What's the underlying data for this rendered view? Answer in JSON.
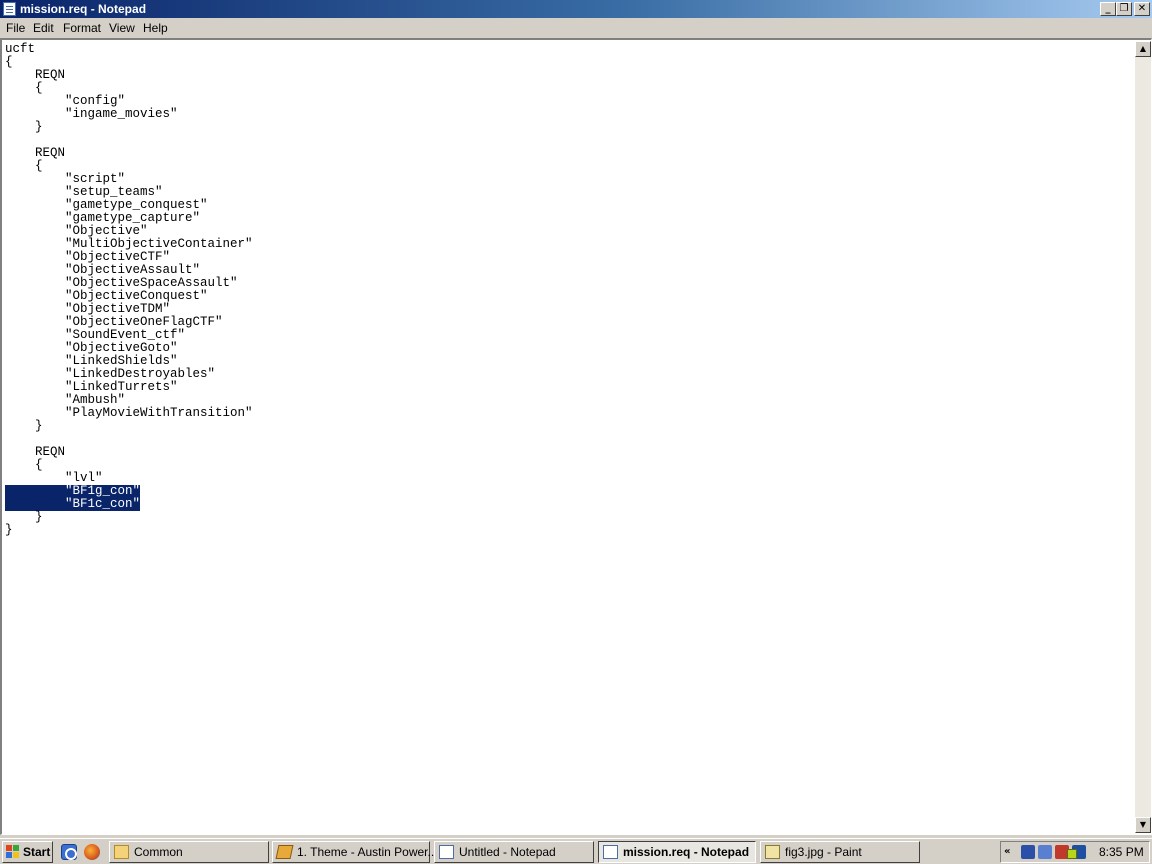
{
  "window": {
    "title": "mission.req - Notepad"
  },
  "titlebar_buttons": {
    "minimize": "_",
    "maximize": "❐",
    "close": "✕"
  },
  "menu": {
    "file": "File",
    "edit": "Edit",
    "format": "Format",
    "view": "View",
    "help": "Help"
  },
  "document": {
    "lines": [
      "ucft",
      "{",
      "    REQN",
      "    {",
      "        \"config\"",
      "        \"ingame_movies\"",
      "    }",
      "",
      "    REQN",
      "    {",
      "        \"script\"",
      "        \"setup_teams\"",
      "        \"gametype_conquest\"",
      "        \"gametype_capture\"",
      "        \"Objective\"",
      "        \"MultiObjectiveContainer\"",
      "        \"ObjectiveCTF\"",
      "        \"ObjectiveAssault\"",
      "        \"ObjectiveSpaceAssault\"",
      "        \"ObjectiveConquest\"",
      "        \"ObjectiveTDM\"",
      "        \"ObjectiveOneFlagCTF\"",
      "        \"SoundEvent_ctf\"",
      "        \"ObjectiveGoto\"",
      "        \"LinkedShields\"",
      "        \"LinkedDestroyables\"",
      "        \"LinkedTurrets\"",
      "        \"Ambush\"",
      "        \"PlayMovieWithTransition\"",
      "    }",
      "",
      "    REQN",
      "    {",
      "        \"lvl\"",
      "        \"BF1g_con\"",
      "        \"BF1c_con\"",
      "    }",
      "}"
    ],
    "selected_lines": [
      34,
      35
    ]
  },
  "scrollbar": {
    "up": "▲",
    "down": "▼"
  },
  "taskbar": {
    "start_label": "Start",
    "tasks": [
      {
        "label": "Common",
        "icon": "folder-icon"
      },
      {
        "label": "1. Theme - Austin Power...",
        "icon": "winamp-icon"
      },
      {
        "label": "Untitled - Notepad",
        "icon": "notepad-icon"
      },
      {
        "label": "mission.req - Notepad",
        "icon": "notepad-icon",
        "active": true
      },
      {
        "label": "fig3.jpg - Paint",
        "icon": "paint-icon"
      }
    ],
    "tray": {
      "expand": "«",
      "clock": "8:35 PM"
    }
  }
}
